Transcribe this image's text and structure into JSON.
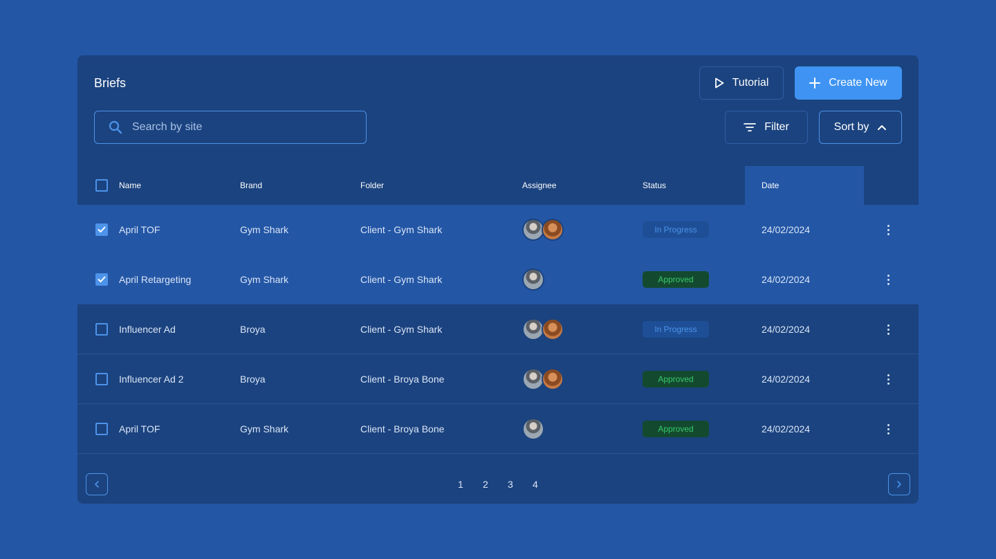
{
  "header": {
    "title": "Briefs",
    "tutorial_label": "Tutorial",
    "create_label": "Create New"
  },
  "search": {
    "placeholder": "Search by site",
    "value": ""
  },
  "toolbar": {
    "filter_label": "Filter",
    "sort_label": "Sort by"
  },
  "table": {
    "columns": [
      "Name",
      "Brand",
      "Folder",
      "Assignee",
      "Status",
      "Date"
    ],
    "rows": [
      {
        "checked": true,
        "name": "April TOF",
        "brand": "Gym Shark",
        "folder": "Client - Gym Shark",
        "assignees": 2,
        "status": "In Progress",
        "date": "24/02/2024"
      },
      {
        "checked": true,
        "name": "April Retargeting",
        "brand": "Gym Shark",
        "folder": "Client - Gym Shark",
        "assignees": 1,
        "status": "Approved",
        "date": "24/02/2024"
      },
      {
        "checked": false,
        "name": "Influencer Ad",
        "brand": "Broya",
        "folder": "Client - Gym Shark",
        "assignees": 2,
        "status": "In Progress",
        "date": "24/02/2024"
      },
      {
        "checked": false,
        "name": "Influencer Ad 2",
        "brand": "Broya",
        "folder": "Client - Broya Bone",
        "assignees": 2,
        "status": "Approved",
        "date": "24/02/2024"
      },
      {
        "checked": false,
        "name": "April TOF",
        "brand": "Gym Shark",
        "folder": "Client - Broya Bone",
        "assignees": 1,
        "status": "Approved",
        "date": "24/02/2024"
      }
    ]
  },
  "pagination": {
    "pages": [
      "1",
      "2",
      "3",
      "4"
    ]
  },
  "colors": {
    "page_bg": "#2356a5",
    "panel_bg": "#1b437f",
    "accent": "#3f94f3",
    "in_progress_text": "#4d93ea",
    "approved_text": "#38c96b"
  },
  "icons": {
    "tutorial": "play-icon",
    "create": "plus-icon",
    "search": "search-icon",
    "filter": "filter-icon",
    "sort": "chevron-up-icon",
    "row_menu": "kebab-menu-icon",
    "prev": "chevron-left-icon",
    "next": "chevron-right-icon"
  }
}
